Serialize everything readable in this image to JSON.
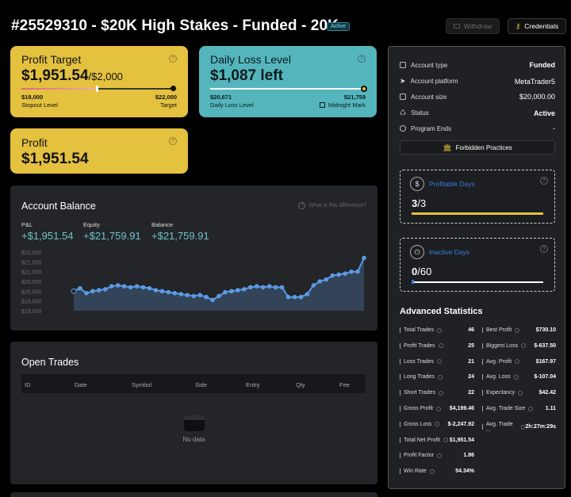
{
  "header": {
    "title": "#25529310 - $20K High Stakes - Funded - 20K",
    "badge": "Active",
    "withdraw_label": "Withdraw",
    "credentials_label": "Credentials"
  },
  "profit_target": {
    "title": "Profit Target",
    "amount": "$1,951.54",
    "target_suffix": "/$2,000",
    "left_value": "$18,000",
    "left_label": "Stopout Level",
    "right_value": "$22,000",
    "right_label": "Target",
    "progress": 0.49
  },
  "daily_loss": {
    "title": "Daily Loss Level",
    "amount": "$1,087 left",
    "left_value": "$20,671",
    "left_label": "Daily Loss Level",
    "right_value": "$21,759",
    "right_label": "Midnight Mark"
  },
  "profit_card": {
    "title": "Profit",
    "amount": "$1,951.54"
  },
  "account_balance": {
    "title": "Account Balance",
    "help_text": "What is this difference?",
    "pnl_label": "P&L",
    "pnl_value": "+$1,951.54",
    "equity_label": "Equity",
    "equity_value": "+$21,759.91",
    "balance_label": "Balance",
    "balance_value": "+$21,759.91"
  },
  "chart_data": {
    "type": "area",
    "title": "",
    "xlabel": "",
    "ylabel": "",
    "ylim": [
      19000,
      22000
    ],
    "y_ticks": [
      "$22,000",
      "$21,500",
      "$21,000",
      "$20,500",
      "$20,000",
      "$19,500",
      "$19,000"
    ],
    "values": [
      20000,
      20150,
      19900,
      20000,
      20050,
      20100,
      20250,
      20300,
      20250,
      20200,
      20250,
      20200,
      20150,
      20050,
      20000,
      19950,
      19900,
      19850,
      19800,
      19750,
      19800,
      19700,
      19550,
      19750,
      19950,
      20000,
      20050,
      20100,
      20200,
      20250,
      20200,
      20250,
      20200,
      20200,
      19700,
      19700,
      19700,
      19850,
      20300,
      20500,
      20600,
      20800,
      20850,
      20900,
      21000,
      21000,
      21700
    ],
    "color": "#5c9ae6"
  },
  "open_trades": {
    "title": "Open Trades",
    "columns": [
      "ID",
      "Date",
      "Symbol",
      "Side",
      "Entry",
      "Qty",
      "Fee"
    ],
    "empty_text": "No data"
  },
  "account_info": {
    "rows": [
      {
        "label": "Account type",
        "value": "Funded"
      },
      {
        "label": "Account platform",
        "value": "MetaTrader5"
      },
      {
        "label": "Account size",
        "value": "$20,000.00"
      },
      {
        "label": "Status",
        "value": "Active"
      },
      {
        "label": "Program Ends",
        "value": "-"
      }
    ],
    "forbidden_label": "Forbidden Practices"
  },
  "profitable_days": {
    "label": "Profitable Days",
    "current": "3",
    "total": "/3",
    "progress": 1.0
  },
  "inactive_days": {
    "label": "Inactive Days",
    "current": "0",
    "total": "/60",
    "progress": 0.0
  },
  "advanced_statistics": {
    "title": "Advanced Statistics",
    "left": [
      {
        "label": "Total Trades",
        "value": "46"
      },
      {
        "label": "Profit Trades",
        "value": "25"
      },
      {
        "label": "Loss Trades",
        "value": "21"
      },
      {
        "label": "Long Trades",
        "value": "24"
      },
      {
        "label": "Short Trades",
        "value": "22"
      },
      {
        "label": "Gross Profit",
        "value": "$4,199.46"
      },
      {
        "label": "Gross Loss",
        "value": "$-2,247.92"
      },
      {
        "label": "Total Net Profit",
        "value": "$1,951.54"
      },
      {
        "label": "Profit Factor",
        "value": "1.86"
      },
      {
        "label": "Win Rate",
        "value": "54.34%"
      }
    ],
    "right": [
      {
        "label": "Best Profit",
        "value": "$730.10"
      },
      {
        "label": "Biggest Loss",
        "value": "$-637.50"
      },
      {
        "label": "Avg. Profit",
        "value": "$167.97"
      },
      {
        "label": "Avg. Loss",
        "value": "$-107.04"
      },
      {
        "label": "Expectancy",
        "value": "$42.42"
      },
      {
        "label": "Avg. Trade Size",
        "value": "1.11"
      },
      {
        "label": "Avg. Trade ...",
        "value": "2h:27m:29s"
      }
    ]
  }
}
